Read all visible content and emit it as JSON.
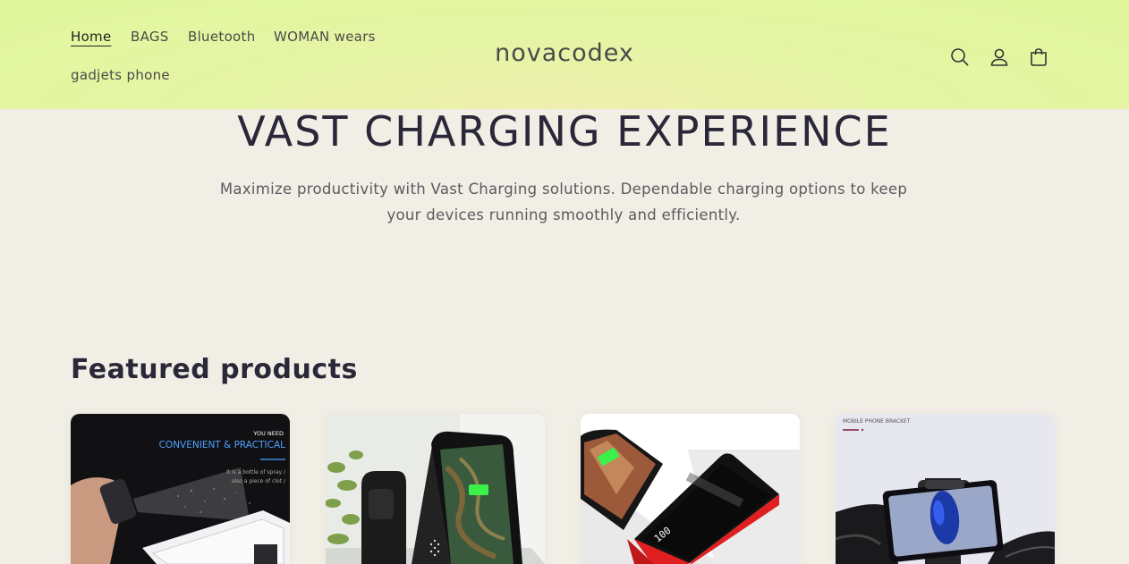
{
  "header": {
    "nav": [
      {
        "label": "Home",
        "active": true
      },
      {
        "label": "BAGS"
      },
      {
        "label": "Bluetooth"
      },
      {
        "label": "WOMAN wears"
      },
      {
        "label": "gadjets phone"
      }
    ],
    "logo": "novacodex",
    "icons": [
      "search-icon",
      "account-icon",
      "cart-icon"
    ]
  },
  "hero": {
    "title": "VAST CHARGING EXPERIENCE",
    "text": "Maximize productivity with Vast Charging solutions. Dependable charging options to keep your devices running smoothly and efficiently."
  },
  "featured": {
    "title": "Featured products",
    "products": [
      {
        "image": "screen-cleaner-spray",
        "caption_small": "YOU NEED",
        "caption_main": "CONVENIENT & PRACTICAL",
        "caption_line1": "It is a bottle of spray /",
        "caption_line2": "also a piece of clot /"
      },
      {
        "image": "wireless-charging-stand"
      },
      {
        "image": "power-bank",
        "display_text": "100"
      },
      {
        "image": "car-phone-bracket",
        "caption_small": "MOBILE PHONE BRACKET"
      }
    ]
  },
  "colors": {
    "header_bg": "#e1f79c",
    "page_bg": "#f1eee6",
    "text": "#2a2838",
    "accent_blue": "#4da3ff"
  }
}
